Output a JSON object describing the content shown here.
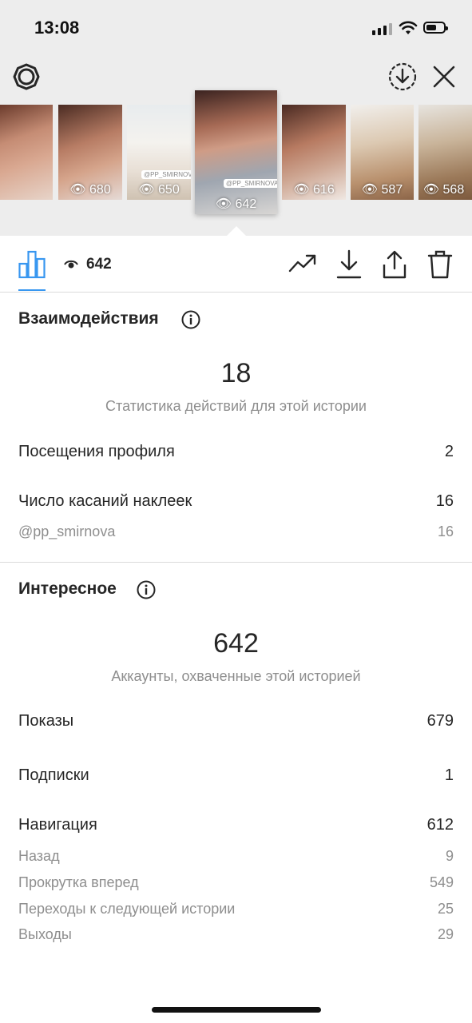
{
  "status_bar": {
    "time": "13:08"
  },
  "thumbnails": [
    {
      "views": ""
    },
    {
      "views": "680"
    },
    {
      "views": "650",
      "tag": "@PP_SMIRNOVA"
    },
    {
      "views": "642",
      "tag": "@PP_SMIRNOVA"
    },
    {
      "views": "616"
    },
    {
      "views": "587"
    },
    {
      "views": "568"
    }
  ],
  "toolbar": {
    "views_count": "642"
  },
  "interactions": {
    "title": "Взаимодействия",
    "total": "18",
    "caption": "Статистика действий для этой истории",
    "rows": [
      {
        "label": "Посещения профиля",
        "value": "2"
      },
      {
        "label": "Число касаний наклеек",
        "value": "16"
      }
    ],
    "sticker": {
      "label": "@pp_smirnova",
      "value": "16"
    }
  },
  "discovery": {
    "title": "Интересное",
    "total": "642",
    "caption": "Аккаунты, охваченные этой историей",
    "rows": [
      {
        "label": "Показы",
        "value": "679"
      },
      {
        "label": "Подписки",
        "value": "1"
      },
      {
        "label": "Навигация",
        "value": "612"
      }
    ],
    "navigation": [
      {
        "label": "Назад",
        "value": "9"
      },
      {
        "label": "Прокрутка вперед",
        "value": "549"
      },
      {
        "label": "Переходы к следующей истории",
        "value": "25"
      },
      {
        "label": "Выходы",
        "value": "29"
      }
    ]
  },
  "colors": {
    "accent": "#3897f0",
    "text": "#262626",
    "muted": "#8e8e8e"
  }
}
